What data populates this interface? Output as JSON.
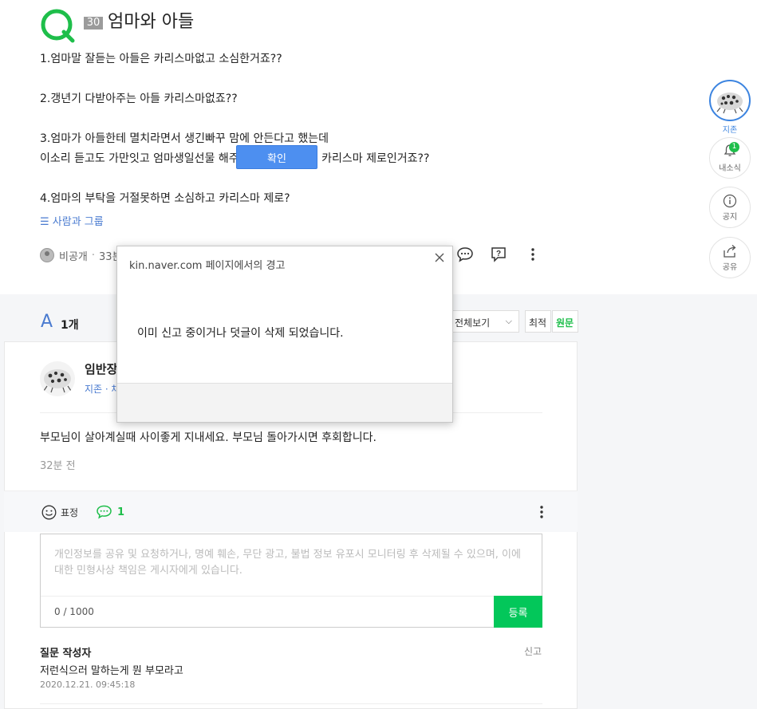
{
  "question": {
    "reward": "30",
    "title": "엄마와 아들",
    "lines": [
      "1.엄마말 잘듣는 아들은 카리스마없고 소심한거죠??",
      "",
      "2.갱년기 다받아주는 아들 카리스마없죠??",
      "",
      "3.엄마가 아들한테 멸치라면서 생긴빠꾸 맘에 안든다고 했는데",
      "이소리 듣고도 가만잇고 엄마생일선물 해주면 호구에 소심에 카리스마 제로인거죠??",
      "",
      "4.엄마의 부탁을 거절못하면 소심하고 카리스마 제로?"
    ],
    "tag": "☰ 사람과 그룹",
    "author": "비공개",
    "time": "33분"
  },
  "rail": {
    "profile_label": "지존",
    "notice_label": "내소식",
    "notice_badge": "1",
    "announce_label": "공지",
    "share_label": "공유"
  },
  "answers": {
    "letter": "A",
    "count": "1개",
    "sort_selected": "전체보기",
    "sort_chevron": "⌵",
    "btn_recent": "최적",
    "btn_original": "원문",
    "first": {
      "name": "임반장",
      "level": "지존 · 채",
      "text": "부모님이 살아계실때 사이좋게 지내세요. 부모님 돌아가시면 후회합니다.",
      "time": "32분 전",
      "emotion_label": "표정",
      "comment_count": "1"
    }
  },
  "comment_form": {
    "placeholder": "개인정보를 공유 및 요청하거나, 명예 훼손, 무단 광고, 불법 정보 유포시 모니터링 후 삭제될 수 있으며, 이에 대한 민형사상 책임은 게시자에게 있습니다.",
    "counter": "0 / 1000",
    "submit_label": "등록"
  },
  "comment": {
    "author": "질문 작성자",
    "report_label": "신고",
    "text": "저런식으러 말하는게 뭔 부모라고",
    "date": "2020.12.21. 09:45:18"
  },
  "dialog": {
    "title": "kin.naver.com 페이지에서의 경고",
    "message": "이미 신고 중이거나 덧글이 삭제 되었습니다.",
    "ok_label": "확인"
  },
  "colors": {
    "brand_green": "#03c75a",
    "link_blue": "#4a7bd0",
    "dialog_button": "#4d8ff0"
  }
}
